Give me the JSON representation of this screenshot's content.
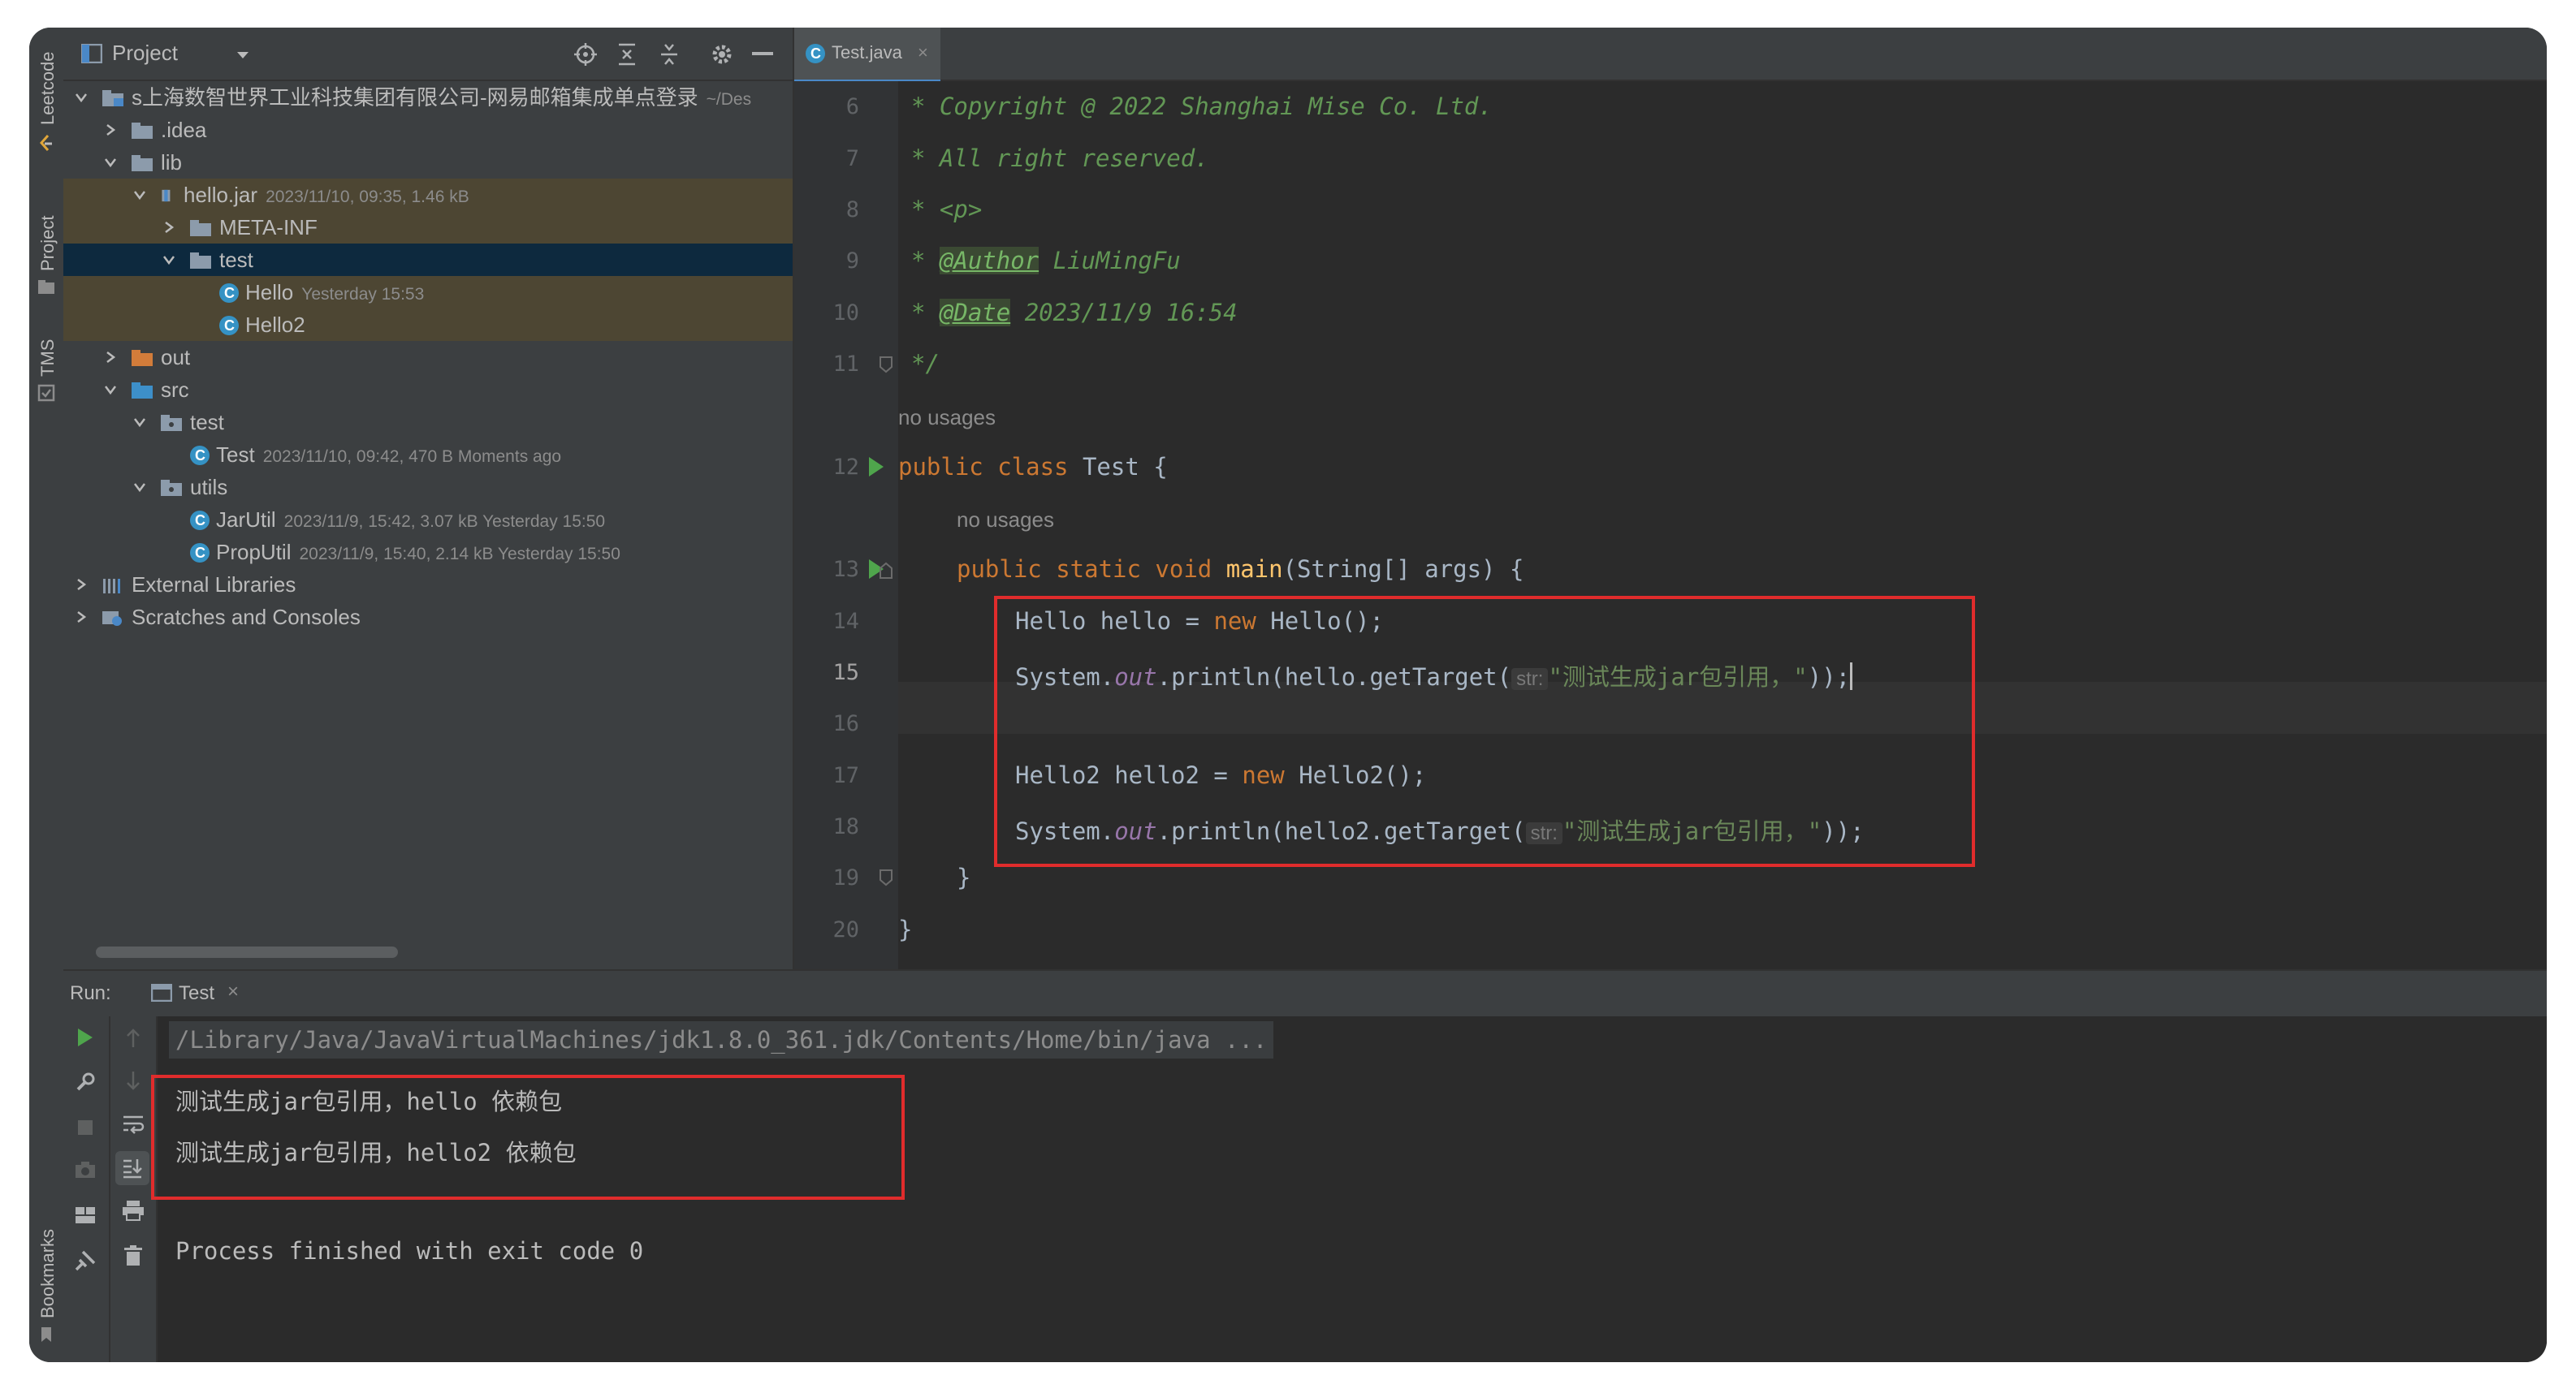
{
  "sidebar_left": {
    "leetcode": "Leetcode",
    "project": "Project",
    "tms": "TMS",
    "bookmarks": "Bookmarks"
  },
  "project_panel": {
    "title": "Project",
    "tree": [
      {
        "label": "s上海数智世界工业科技集团有限公司-网易邮箱集成单点登录",
        "meta": "~/Des"
      },
      {
        "label": ".idea",
        "meta": ""
      },
      {
        "label": "lib",
        "meta": ""
      },
      {
        "label": "hello.jar",
        "meta": "2023/11/10, 09:35, 1.46 kB"
      },
      {
        "label": "META-INF",
        "meta": ""
      },
      {
        "label": "test",
        "meta": ""
      },
      {
        "label": "Hello",
        "meta": "Yesterday 15:53"
      },
      {
        "label": "Hello2",
        "meta": ""
      },
      {
        "label": "out",
        "meta": ""
      },
      {
        "label": "src",
        "meta": ""
      },
      {
        "label": "test",
        "meta": ""
      },
      {
        "label": "Test",
        "meta": "2023/11/10, 09:42, 470 B Moments ago"
      },
      {
        "label": "utils",
        "meta": ""
      },
      {
        "label": "JarUtil",
        "meta": "2023/11/9, 15:42, 3.07 kB Yesterday 15:50"
      },
      {
        "label": "PropUtil",
        "meta": "2023/11/9, 15:40, 2.14 kB Yesterday 15:50"
      },
      {
        "label": "External Libraries",
        "meta": ""
      },
      {
        "label": "Scratches and Consoles",
        "meta": ""
      }
    ]
  },
  "editor": {
    "tab_label": "Test.java",
    "line_numbers": [
      "6",
      "7",
      "8",
      "9",
      "10",
      "11",
      "12",
      "13",
      "14",
      "15",
      "16",
      "17",
      "18",
      "19",
      "20"
    ],
    "no_usages": "no usages",
    "lines": {
      "l6": "* Copyright @ 2022 Shanghai Mise Co. Ltd.",
      "l7": "* All right reserved.",
      "l8": "* <p>",
      "l9_tag": "@Author",
      "l9_rest": " LiuMingFu",
      "l10_tag": "@Date",
      "l10_rest": " 2023/11/9 16:54",
      "l11": "*/",
      "l12_kw": "public class",
      "l12_rest": " Test {",
      "l13_kw": "public static void",
      "l13_fn": " main",
      "l13_rest": "(String[] args) {",
      "l14_a": "Hello hello = ",
      "l14_kw": "new",
      "l14_b": " Hello();",
      "l15_a": "System.",
      "l15_out": "out",
      "l15_b": ".println(hello.getTarget(",
      "str_hint": "str:",
      "l15_str": "\"测试生成jar包引用，\"",
      "l15_c": "));",
      "l17_a": "Hello2 hello2 = ",
      "l17_kw": "new",
      "l17_b": " Hello2();",
      "l18_a": "System.",
      "l18_out": "out",
      "l18_b": ".println(hello2.getTarget(",
      "l18_str": "\"测试生成jar包引用，\"",
      "l18_c": "));",
      "l19": "}",
      "l20": "}"
    }
  },
  "run_panel": {
    "label": "Run:",
    "tab": "Test",
    "console": [
      "/Library/Java/JavaVirtualMachines/jdk1.8.0_361.jdk/Contents/Home/bin/java ...",
      "测试生成jar包引用，hello 依赖包",
      "测试生成jar包引用，hello2 依赖包",
      "",
      "Process finished with exit code 0"
    ]
  },
  "colors": {
    "highlight_box": "#e02c2c",
    "selection": "#0d293e",
    "accent_tab": "#4a88c7"
  }
}
